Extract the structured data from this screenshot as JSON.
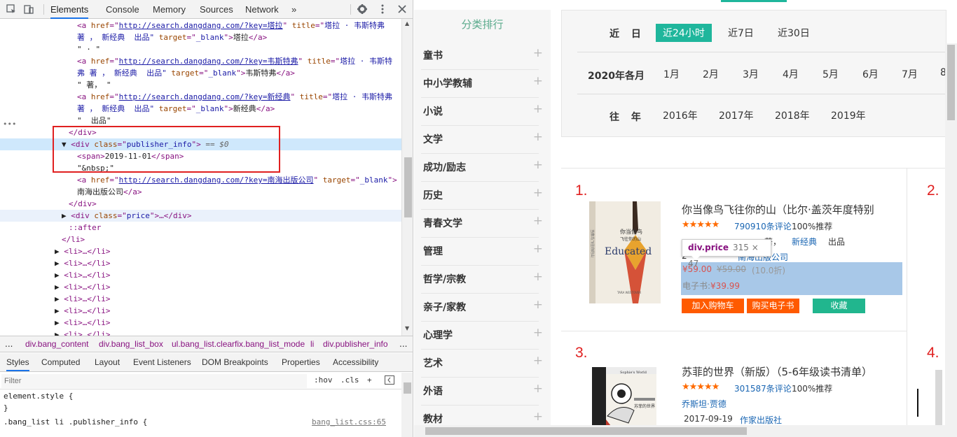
{
  "devtools": {
    "tabs": [
      "Elements",
      "Console",
      "Memory",
      "Sources",
      "Network"
    ],
    "more_tabs": "»",
    "code_lines": [
      {
        "indent": 110,
        "parts": [
          [
            "t",
            "<a "
          ],
          [
            "a",
            "href"
          ],
          [
            "t",
            "=\""
          ],
          [
            "l",
            "http://search.dangdang.com/?key=塔拉"
          ],
          [
            "t",
            "\" "
          ],
          [
            "a",
            "title"
          ],
          [
            "t",
            "=\""
          ],
          [
            "v",
            "塔拉 · 韦斯特弗"
          ]
        ]
      },
      {
        "indent": 110,
        "parts": [
          [
            "v",
            "著 ， 新经典  出品\" "
          ],
          [
            "a",
            "target"
          ],
          [
            "t",
            "=\""
          ],
          [
            "v",
            "_blank"
          ],
          [
            "t",
            "\">"
          ],
          [
            "p",
            "塔拉"
          ],
          [
            "t",
            "</a>"
          ]
        ]
      },
      {
        "indent": 110,
        "parts": [
          [
            "p",
            "\" · \""
          ]
        ]
      },
      {
        "indent": 110,
        "parts": [
          [
            "t",
            "<a "
          ],
          [
            "a",
            "href"
          ],
          [
            "t",
            "=\""
          ],
          [
            "l",
            "http://search.dangdang.com/?key=韦斯特弗"
          ],
          [
            "t",
            "\" "
          ],
          [
            "a",
            "title"
          ],
          [
            "t",
            "=\""
          ],
          [
            "v",
            "塔拉 · 韦斯特"
          ]
        ]
      },
      {
        "indent": 110,
        "parts": [
          [
            "v",
            "弗 著 ， 新经典  出品\" "
          ],
          [
            "a",
            "target"
          ],
          [
            "t",
            "=\""
          ],
          [
            "v",
            "_blank"
          ],
          [
            "t",
            "\">"
          ],
          [
            "p",
            "韦斯特弗"
          ],
          [
            "t",
            "</a>"
          ]
        ]
      },
      {
        "indent": 110,
        "parts": [
          [
            "p",
            "\" 著， \""
          ]
        ]
      },
      {
        "indent": 110,
        "parts": [
          [
            "t",
            "<a "
          ],
          [
            "a",
            "href"
          ],
          [
            "t",
            "=\""
          ],
          [
            "l",
            "http://search.dangdang.com/?key=新经典"
          ],
          [
            "t",
            "\" "
          ],
          [
            "a",
            "title"
          ],
          [
            "t",
            "=\""
          ],
          [
            "v",
            "塔拉 · 韦斯特弗"
          ]
        ]
      },
      {
        "indent": 110,
        "parts": [
          [
            "v",
            "著 ， 新经典  出品\" "
          ],
          [
            "a",
            "target"
          ],
          [
            "t",
            "=\""
          ],
          [
            "v",
            "_blank"
          ],
          [
            "t",
            "\">"
          ],
          [
            "p",
            "新经典"
          ],
          [
            "t",
            "</a>"
          ]
        ]
      },
      {
        "indent": 110,
        "parts": [
          [
            "p",
            "\"  出品\""
          ]
        ]
      },
      {
        "indent": 98,
        "parts": [
          [
            "t",
            "</div>"
          ]
        ]
      },
      {
        "indent": 88,
        "cls": "sel",
        "parts": [
          [
            "p",
            "▼ "
          ],
          [
            "t",
            "<div "
          ],
          [
            "a",
            "class"
          ],
          [
            "t",
            "=\""
          ],
          [
            "v",
            "publisher_info"
          ],
          [
            "t",
            "\">"
          ],
          [
            "c",
            " == $0"
          ]
        ]
      },
      {
        "indent": 110,
        "parts": [
          [
            "t",
            "<span>"
          ],
          [
            "p",
            "2019-11-01"
          ],
          [
            "t",
            "</span>"
          ]
        ]
      },
      {
        "indent": 110,
        "parts": [
          [
            "p",
            "\"&nbsp;\""
          ]
        ]
      },
      {
        "indent": 110,
        "parts": [
          [
            "t",
            "<a "
          ],
          [
            "a",
            "href"
          ],
          [
            "t",
            "=\""
          ],
          [
            "l",
            "http://search.dangdang.com/?key=南海出版公司"
          ],
          [
            "t",
            "\" "
          ],
          [
            "a",
            "target"
          ],
          [
            "t",
            "=\""
          ],
          [
            "v",
            "_blank"
          ],
          [
            "t",
            "\">"
          ]
        ]
      },
      {
        "indent": 110,
        "parts": [
          [
            "p",
            "南海出版公司"
          ],
          [
            "t",
            "</a>"
          ]
        ]
      },
      {
        "indent": 98,
        "parts": [
          [
            "t",
            "</div>"
          ]
        ]
      },
      {
        "indent": 88,
        "cls": "hov",
        "parts": [
          [
            "p",
            "▶ "
          ],
          [
            "t",
            "<div "
          ],
          [
            "a",
            "class"
          ],
          [
            "t",
            "=\""
          ],
          [
            "v",
            "price"
          ],
          [
            "t",
            "\">…</div>"
          ]
        ]
      },
      {
        "indent": 98,
        "parts": [
          [
            "t",
            "::after"
          ]
        ]
      },
      {
        "indent": 88,
        "parts": [
          [
            "t",
            "</li>"
          ]
        ]
      },
      {
        "indent": 78,
        "parts": [
          [
            "p",
            "▶ "
          ],
          [
            "t",
            "<li>…</li>"
          ]
        ]
      },
      {
        "indent": 78,
        "parts": [
          [
            "p",
            "▶ "
          ],
          [
            "t",
            "<li>…</li>"
          ]
        ]
      },
      {
        "indent": 78,
        "parts": [
          [
            "p",
            "▶ "
          ],
          [
            "t",
            "<li>…</li>"
          ]
        ]
      },
      {
        "indent": 78,
        "parts": [
          [
            "p",
            "▶ "
          ],
          [
            "t",
            "<li>…</li>"
          ]
        ]
      },
      {
        "indent": 78,
        "parts": [
          [
            "p",
            "▶ "
          ],
          [
            "t",
            "<li>…</li>"
          ]
        ]
      },
      {
        "indent": 78,
        "parts": [
          [
            "p",
            "▶ "
          ],
          [
            "t",
            "<li>…</li>"
          ]
        ]
      },
      {
        "indent": 78,
        "parts": [
          [
            "p",
            "▶ "
          ],
          [
            "t",
            "<li>…</li>"
          ]
        ]
      },
      {
        "indent": 78,
        "parts": [
          [
            "p",
            "▶ "
          ],
          [
            "t",
            "<li>…</li>"
          ]
        ]
      }
    ],
    "breadcrumbs": [
      "div.bang_content",
      "div.bang_list_box",
      "ul.bang_list.clearfix.bang_list_mode",
      "li",
      "div.publisher_info"
    ],
    "crumb_more": "...",
    "subtabs": [
      "Styles",
      "Computed",
      "Layout",
      "Event Listeners",
      "DOM Breakpoints",
      "Properties",
      "Accessibility"
    ],
    "filter_placeholder": "Filter",
    "hov": ":hov",
    "cls": ".cls",
    "styles_lines": [
      "element.style {",
      "}",
      ".bang_list li .publisher_info {"
    ],
    "styles_file": "bang_list.css:65"
  },
  "page": {
    "sidebar_title": "分类排行",
    "categories": [
      "童书",
      "中小学教辅",
      "小说",
      "文学",
      "成功/励志",
      "历史",
      "青春文学",
      "管理",
      "哲学/宗教",
      "亲子/家教",
      "心理学",
      "艺术",
      "外语",
      "教材"
    ],
    "filters": {
      "recent_label": "近  日",
      "recent_opts": [
        "近24小时",
        "近7日",
        "近30日"
      ],
      "month_label": "2020年各月",
      "month_opts": [
        "1月",
        "2月",
        "3月",
        "4月",
        "5月",
        "6月",
        "7月",
        "8"
      ],
      "year_label": "往  年",
      "year_opts": [
        "2016年",
        "2017年",
        "2018年",
        "2019年"
      ]
    },
    "books": [
      {
        "rank": "1.",
        "title": "你当像鸟飞往你的山（比尔·盖茨年度特别",
        "stars": "★★★★★",
        "reviews": "790910条评论",
        "recommend": "100%推荐",
        "author_frag": "著，",
        "brand": "新经典",
        "brand_suffix": "出品",
        "date_frag": "2",
        "publisher": "南海出版公司",
        "price_now": "¥59.00",
        "price_old": "¥59.00",
        "discount": "(10.0折)",
        "ebook_label": "电子书:",
        "ebook_price": "¥39.99",
        "btn_cart": "加入购物车",
        "btn_ebook": "购买电子书",
        "btn_fav": "收藏",
        "cover_cn": "你当像鸟飞往你的山",
        "cover_en": "Educated",
        "cover_side": "当像鸟飞往你的山",
        "cover_author": "TARA WESTOVER"
      },
      {
        "rank": "3.",
        "title": "苏菲的世界（新版）（5-6年级读书清单）",
        "stars": "★★★★★",
        "reviews": "301587条评论",
        "recommend": "100%推荐",
        "author": "乔斯坦·贾德",
        "date": "2017-09-19",
        "publisher": "作家出版社",
        "cover_cn": "苏菲的世界",
        "cover_en": "Sophie's World"
      }
    ],
    "rank_right_top": "2.",
    "rank_right_bottom": "4.",
    "tooltip": {
      "name": "div.price",
      "size": "315 × 47"
    }
  },
  "colors": {
    "accent": "#1fb69c",
    "rank": "#e02020",
    "stars": "#ff6a00",
    "button": "#ff5a00",
    "fav": "#21b68e",
    "link": "#1a66b3"
  }
}
